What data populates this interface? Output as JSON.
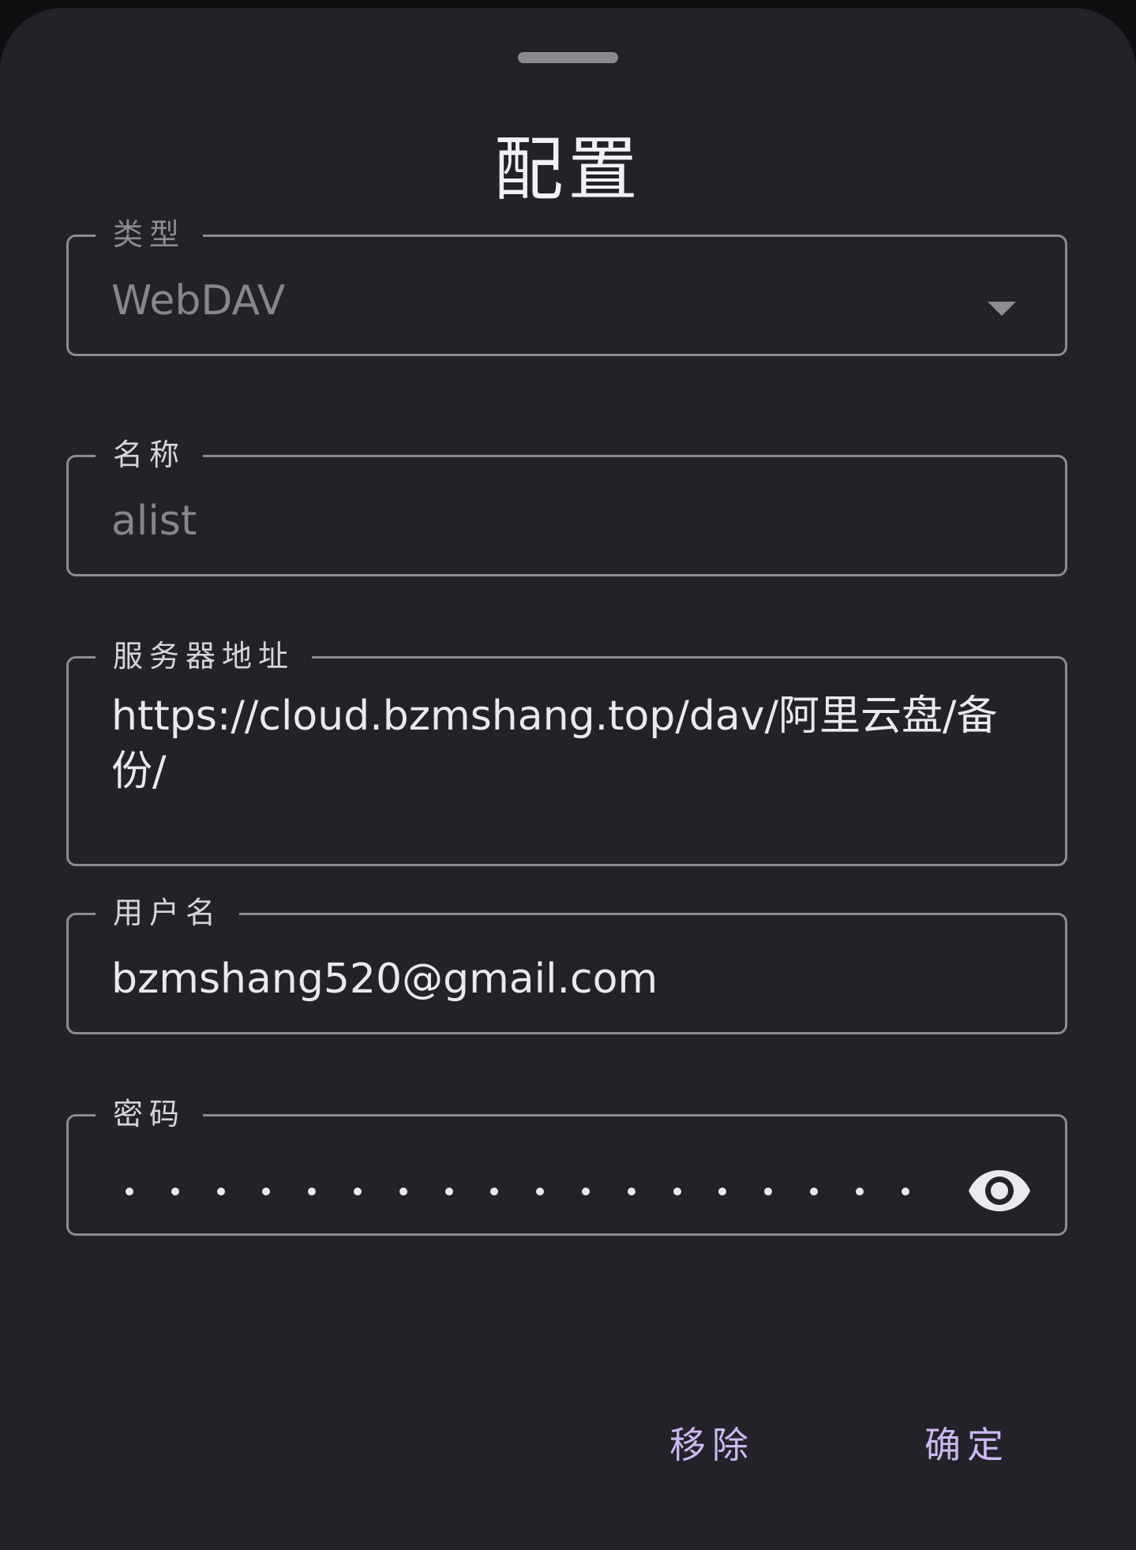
{
  "dialog": {
    "title": "配置"
  },
  "fields": {
    "type": {
      "label": "类型",
      "value": "WebDAV"
    },
    "name": {
      "label": "名称",
      "placeholder": "alist"
    },
    "server": {
      "label": "服务器地址",
      "value": "https://cloud.bzmshang.top/dav/阿里云盘/备份/"
    },
    "username": {
      "label": "用户名",
      "value": "bzmshang520@gmail.com"
    },
    "password": {
      "label": "密码",
      "masked_length": 18,
      "toggle_icon": "eye-icon"
    }
  },
  "actions": {
    "remove_label": "移除",
    "confirm_label": "确定"
  },
  "colors": {
    "background": "#232228",
    "outline": "#8d8c92",
    "accent": "#cdb8f3",
    "text": "#ebe9ef"
  }
}
